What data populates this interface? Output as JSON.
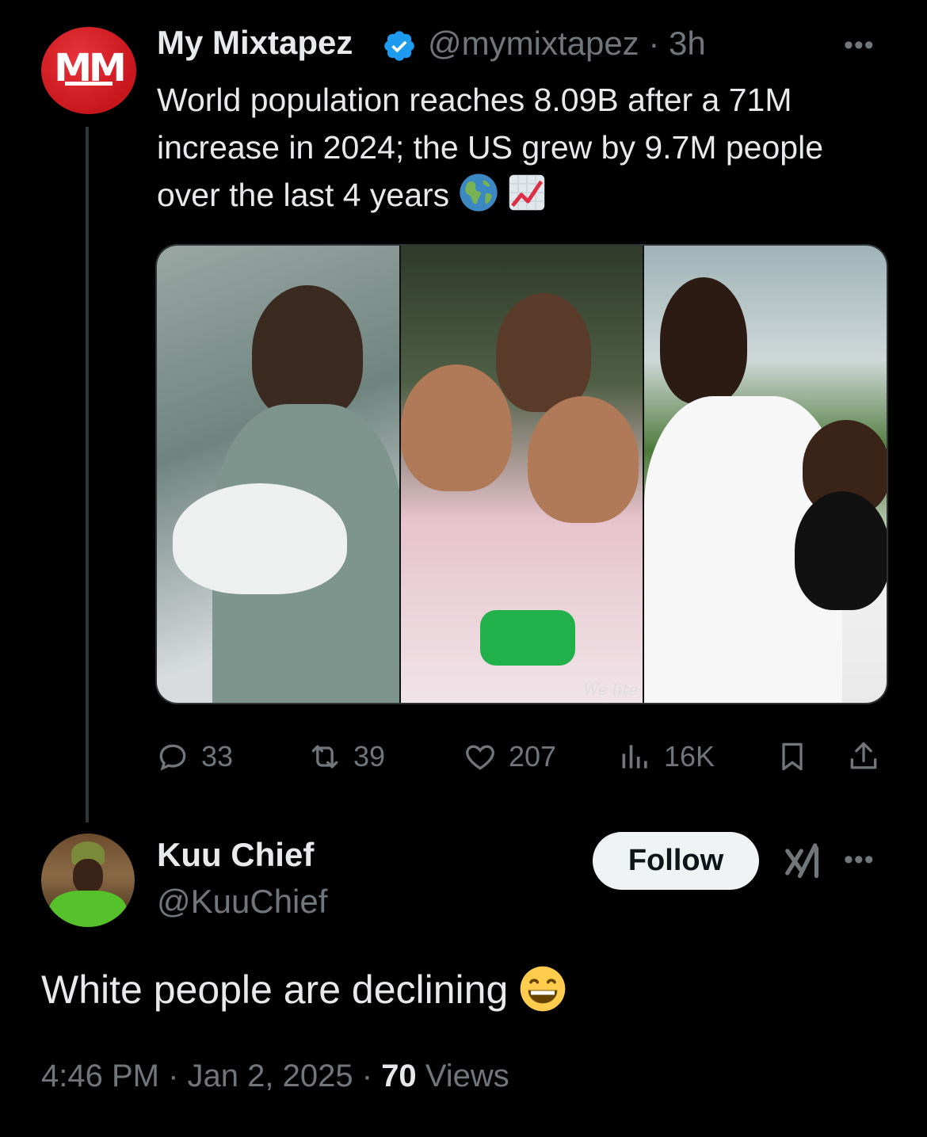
{
  "quoted": {
    "avatar_text": "MM",
    "name": "My Mixtapez",
    "handle": "@mymixtapez",
    "sep": "·",
    "age": "3h",
    "more": "•••",
    "text": "World population reaches 8.09B after a 71M increase in 2024; the US grew by 9.7M people over the last 4 years",
    "emojis": [
      "globe-americas-icon",
      "chart-increasing-icon"
    ],
    "watermark": "We lite",
    "stats": {
      "replies": "33",
      "reposts": "39",
      "likes": "207",
      "views": "16K"
    }
  },
  "reply": {
    "name": "Kuu Chief",
    "handle": "@KuuChief",
    "follow_label": "Follow",
    "more": "•••",
    "text": "White people are declining",
    "emoji": "grinning-face-icon",
    "time": "4:46 PM",
    "date": "Jan 2, 2025",
    "views_count": "70",
    "views_label": "Views",
    "sep": "·"
  },
  "colors": {
    "background": "#000000",
    "text": "#e7e9ea",
    "muted": "#71767b",
    "verified_blue": "#1d9bf0",
    "brand_red": "#c8161d"
  }
}
